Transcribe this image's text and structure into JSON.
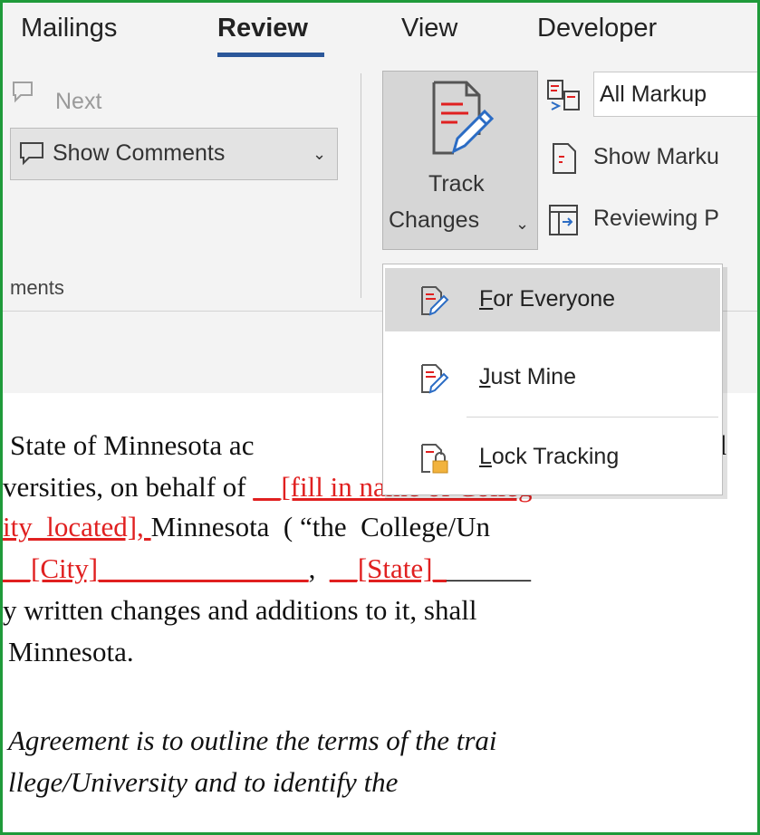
{
  "tabs": {
    "mailings": "Mailings",
    "review": "Review",
    "view": "View",
    "developer": "Developer"
  },
  "ribbon": {
    "next_label": "Next",
    "show_comments_label": "Show Comments",
    "group_label_partial": "ments",
    "track_changes_line1": "Track",
    "track_changes_line2": "Changes",
    "all_markup": "All Markup",
    "show_markup": "Show Marku",
    "reviewing_pane": "Reviewing P"
  },
  "track_menu": {
    "for_everyone_accel": "F",
    "for_everyone_rest": "or Everyone",
    "just_mine_accel": "J",
    "just_mine_rest": "ust Mine",
    "lock_tracking_accel": "L",
    "lock_tracking_rest": "ock Tracking"
  },
  "document": {
    "line1_a": "State of Minnesota ac",
    "line1_b": "rd",
    "line2_a": "versities, on behalf of ",
    "line2_red": "__[fill in name of Colleg",
    "line3_red": "ity  located], ",
    "line3_b": "Minnesota  ( “the  College/Un",
    "line4_red1": "__[City]_______________",
    "line4_mid": ",  ",
    "line4_red2": "__[State]_",
    "line4_tail": "______",
    "line5": "y written changes and additions to it, shall",
    "line6": "Minnesota.",
    "line7": "Agreement is to outline the terms of the trai",
    "line8": "llege/University and to identify the"
  },
  "colors": {
    "frame": "#1f9a3a",
    "accent": "#2b579a",
    "track_red": "#e02020"
  }
}
